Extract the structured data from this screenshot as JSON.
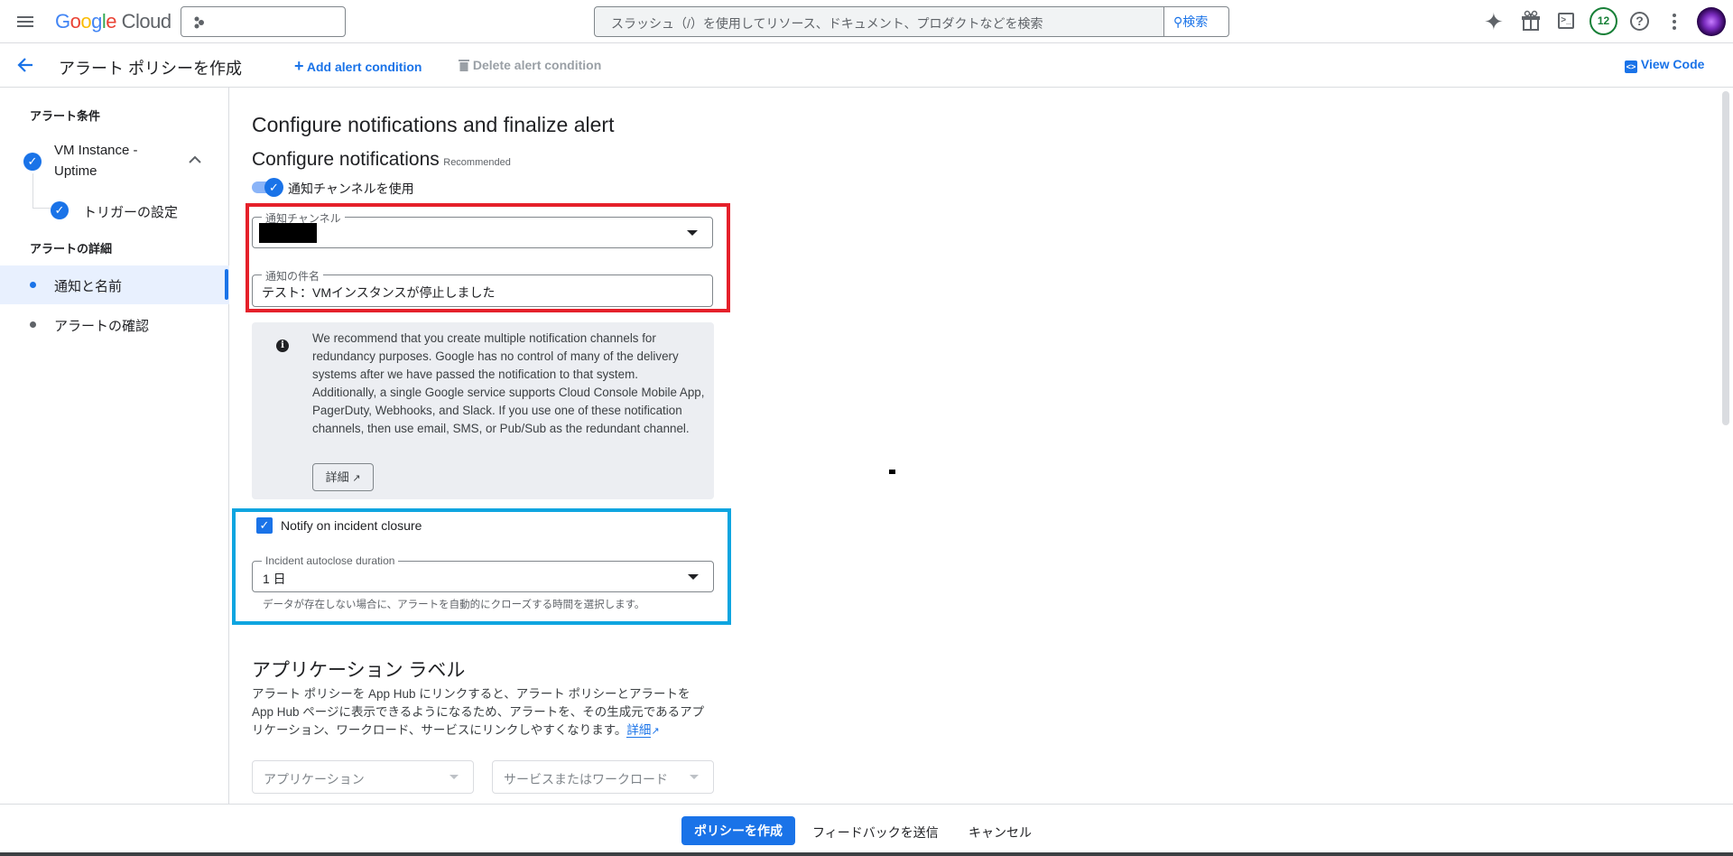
{
  "topbar": {
    "logo_text": "Google Cloud",
    "search_placeholder": "スラッシュ（/）を使用してリソース、ドキュメント、プロダクトなどを検索",
    "search_button": "検索",
    "notification_count": "12"
  },
  "subheader": {
    "title": "アラート ポリシーを作成",
    "add_condition": "Add alert condition",
    "delete_condition": "Delete alert condition",
    "view_code": "View Code"
  },
  "sidebar": {
    "section_conditions": "アラート条件",
    "condition_name": "VM Instance - Uptime",
    "trigger": "トリガーの設定",
    "section_details": "アラートの詳細",
    "items": [
      {
        "label": "通知と名前",
        "selected": true
      },
      {
        "label": "アラートの確認",
        "selected": false
      }
    ]
  },
  "main": {
    "heading": "Configure notifications and finalize alert",
    "subheading": "Configure notifications",
    "recommended": "Recommended",
    "toggle_label": "通知チャンネルを使用",
    "toggle_on": true,
    "channel_label": "通知チャンネル",
    "subject_label": "通知の件名",
    "subject_value": "テスト：VMインスタンスが停止しました",
    "info_text": "We recommend that you create multiple notification channels for redundancy purposes. Google has no control of many of the delivery systems after we have passed the notification to that system. Additionally, a single Google service supports Cloud Console Mobile App, PagerDuty, Webhooks, and Slack. If you use one of these notification channels, then use email, SMS, or Pub/Sub as the redundant channel.",
    "info_button": "詳細",
    "notify_closure_label": "Notify on incident closure",
    "notify_closure_checked": true,
    "autoclose_label": "Incident autoclose duration",
    "autoclose_value": "1 日",
    "autoclose_help": "データが存在しない場合に、アラートを自動的にクローズする時間を選択します。",
    "app_heading": "アプリケーション ラベル",
    "app_text": "アラート ポリシーを App Hub にリンクすると、アラート ポリシーとアラートを App Hub ページに表示できるようになるため、アラートを、その生成元であるアプリケーション、ワークロード、サービスにリンクしやすくなります。",
    "app_link": "詳細",
    "app_select": "アプリケーション",
    "service_select": "サービスまたはワークロード"
  },
  "footer": {
    "create": "ポリシーを作成",
    "feedback": "フィードバックを送信",
    "cancel": "キャンセル"
  },
  "colors": {
    "accent": "#1a73e8",
    "highlight_red": "#e5202a",
    "highlight_blue": "#0ea5e0",
    "info_bg": "#eceef2"
  }
}
